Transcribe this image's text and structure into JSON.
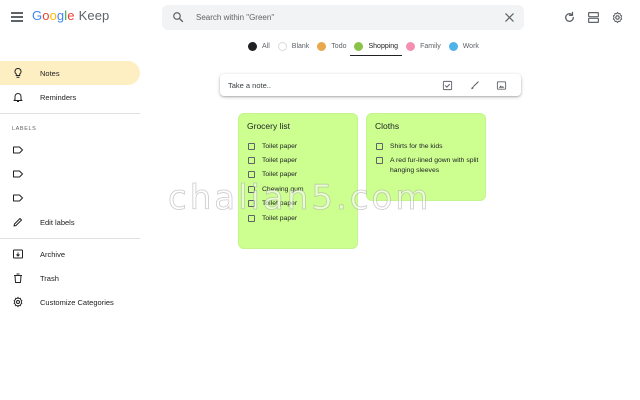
{
  "header": {
    "logo_google": [
      "G",
      "o",
      "o",
      "g",
      "l",
      "e"
    ],
    "logo_app": "Keep",
    "search_placeholder": "Search within \"Green\""
  },
  "categories": [
    {
      "label": "All",
      "color": "#202124",
      "active": false
    },
    {
      "label": "Blank",
      "color": "#ffffff",
      "active": false
    },
    {
      "label": "Todo",
      "color": "#e8a84c",
      "active": false
    },
    {
      "label": "Shopping",
      "color": "#8bc34a",
      "active": true
    },
    {
      "label": "Family",
      "color": "#f48fb1",
      "active": false
    },
    {
      "label": "Work",
      "color": "#4fb3e8",
      "active": false
    }
  ],
  "sidebar": {
    "notes": "Notes",
    "reminders": "Reminders",
    "labels_heading": "LABELS",
    "edit_labels": "Edit labels",
    "archive": "Archive",
    "trash": "Trash",
    "customize": "Customize Categories"
  },
  "take_note": {
    "placeholder": "Take a note.."
  },
  "notes": [
    {
      "title": "Grocery list",
      "items": [
        "Toilet paper",
        "Toilet paper",
        "Toilet paper",
        "Chewing gum",
        "Toilet paper",
        "Toilet paper"
      ]
    },
    {
      "title": "Cloths",
      "items": [
        "Shirts for the kids",
        "A red fur-lined gown with split hanging sleeves"
      ]
    }
  ],
  "watermark": "chalian5.com",
  "colors": {
    "active_nav": "#feefc3",
    "note_green": "#ccff90"
  }
}
